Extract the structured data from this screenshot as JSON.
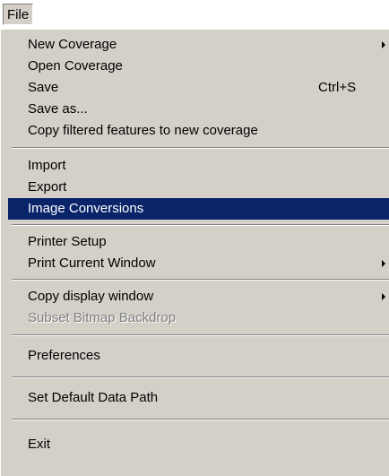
{
  "menubar": {
    "file_label": "File"
  },
  "menu": {
    "new_coverage": "New Coverage",
    "open_coverage": "Open Coverage",
    "save": "Save",
    "save_shortcut": "Ctrl+S",
    "save_as": "Save as...",
    "copy_filtered": "Copy filtered features to new coverage",
    "import": "Import",
    "export": "Export",
    "image_conversions": "Image Conversions",
    "printer_setup": "Printer Setup",
    "print_current_window": "Print Current Window",
    "copy_display_window": "Copy display window",
    "subset_bitmap_backdrop": "Subset Bitmap Backdrop",
    "preferences": "Preferences",
    "set_default_data_path": "Set Default Data Path",
    "exit": "Exit"
  },
  "state": {
    "highlighted_item": "Image Conversions",
    "disabled_item": "Subset Bitmap Backdrop"
  },
  "colors": {
    "menu_background": "#d4d0c8",
    "highlight": "#0a246a",
    "highlight_text": "#ffffff",
    "disabled_text": "#808080"
  },
  "icons": {
    "submenu_arrow": "chevron-right-icon"
  }
}
